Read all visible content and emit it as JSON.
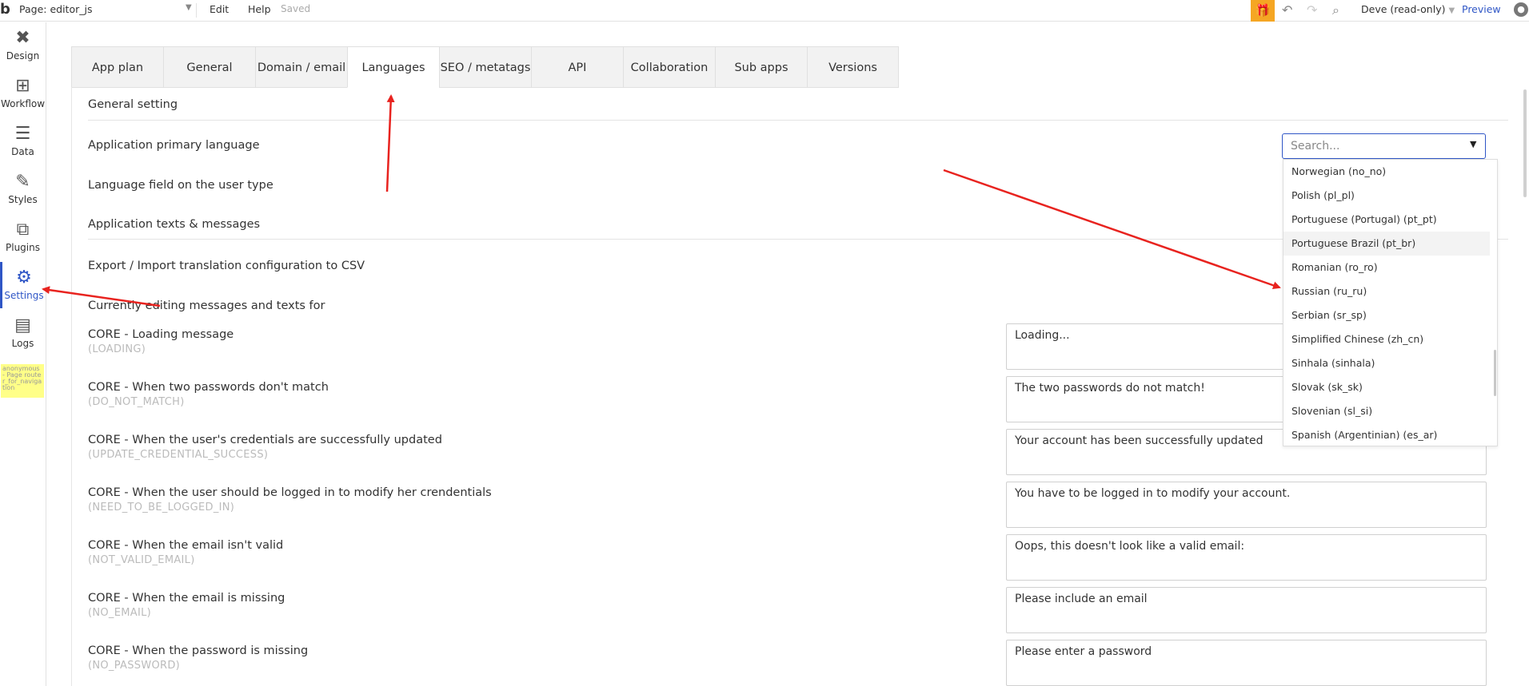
{
  "topbar": {
    "logo": "b",
    "page_select": "Page: editor_js",
    "menu_edit": "Edit",
    "menu_help": "Help",
    "status": "Saved",
    "user": "Deve (read-only)",
    "preview": "Preview"
  },
  "sidebar": {
    "items": [
      {
        "label": "Design"
      },
      {
        "label": "Workflow"
      },
      {
        "label": "Data"
      },
      {
        "label": "Styles"
      },
      {
        "label": "Plugins"
      },
      {
        "label": "Settings"
      },
      {
        "label": "Logs"
      }
    ],
    "anon_note": "anonymous - Page router_for_navigation"
  },
  "tabs": [
    {
      "label": "App plan"
    },
    {
      "label": "General"
    },
    {
      "label": "Domain / email"
    },
    {
      "label": "Languages"
    },
    {
      "label": "SEO / metatags"
    },
    {
      "label": "API"
    },
    {
      "label": "Collaboration"
    },
    {
      "label": "Sub apps"
    },
    {
      "label": "Versions"
    }
  ],
  "general": {
    "title": "General setting",
    "primary_language_label": "Application primary language",
    "language_field_label": "Language field on the user type",
    "search_placeholder": "Search..."
  },
  "texts": {
    "title": "Application texts & messages",
    "export_label": "Export / Import translation configuration to CSV",
    "editing_label": "Currently editing messages and texts for"
  },
  "messages": [
    {
      "label": "CORE - Loading message",
      "key": "(LOADING)",
      "value": "Loading..."
    },
    {
      "label": "CORE - When two passwords don't match",
      "key": "(DO_NOT_MATCH)",
      "value": "The two passwords do not match!"
    },
    {
      "label": "CORE - When the user's credentials are successfully updated",
      "key": "(UPDATE_CREDENTIAL_SUCCESS)",
      "value": "Your account has been successfully updated"
    },
    {
      "label": "CORE - When the user should be logged in to modify her crendentials",
      "key": "(NEED_TO_BE_LOGGED_IN)",
      "value": "You have to be logged in to modify your account."
    },
    {
      "label": "CORE - When the email isn't valid",
      "key": "(NOT_VALID_EMAIL)",
      "value": "Oops, this doesn't look like a valid email:"
    },
    {
      "label": "CORE - When the email is missing",
      "key": "(NO_EMAIL)",
      "value": "Please include an email"
    },
    {
      "label": "CORE - When the password is missing",
      "key": "(NO_PASSWORD)",
      "value": "Please enter a password"
    }
  ],
  "language_options": [
    "Norwegian (no_no)",
    "Polish (pl_pl)",
    "Portuguese (Portugal) (pt_pt)",
    "Portuguese Brazil (pt_br)",
    "Romanian (ro_ro)",
    "Russian (ru_ru)",
    "Serbian (sr_sp)",
    "Simplified Chinese (zh_cn)",
    "Sinhala (sinhala)",
    "Slovak (sk_sk)",
    "Slovenian (sl_si)",
    "Spanish (Argentinian) (es_ar)"
  ],
  "colors": {
    "accent": "#2f56c6",
    "gift": "#f5a623",
    "annotation_arrow": "#e8231f",
    "note_bg": "#ffff88"
  }
}
